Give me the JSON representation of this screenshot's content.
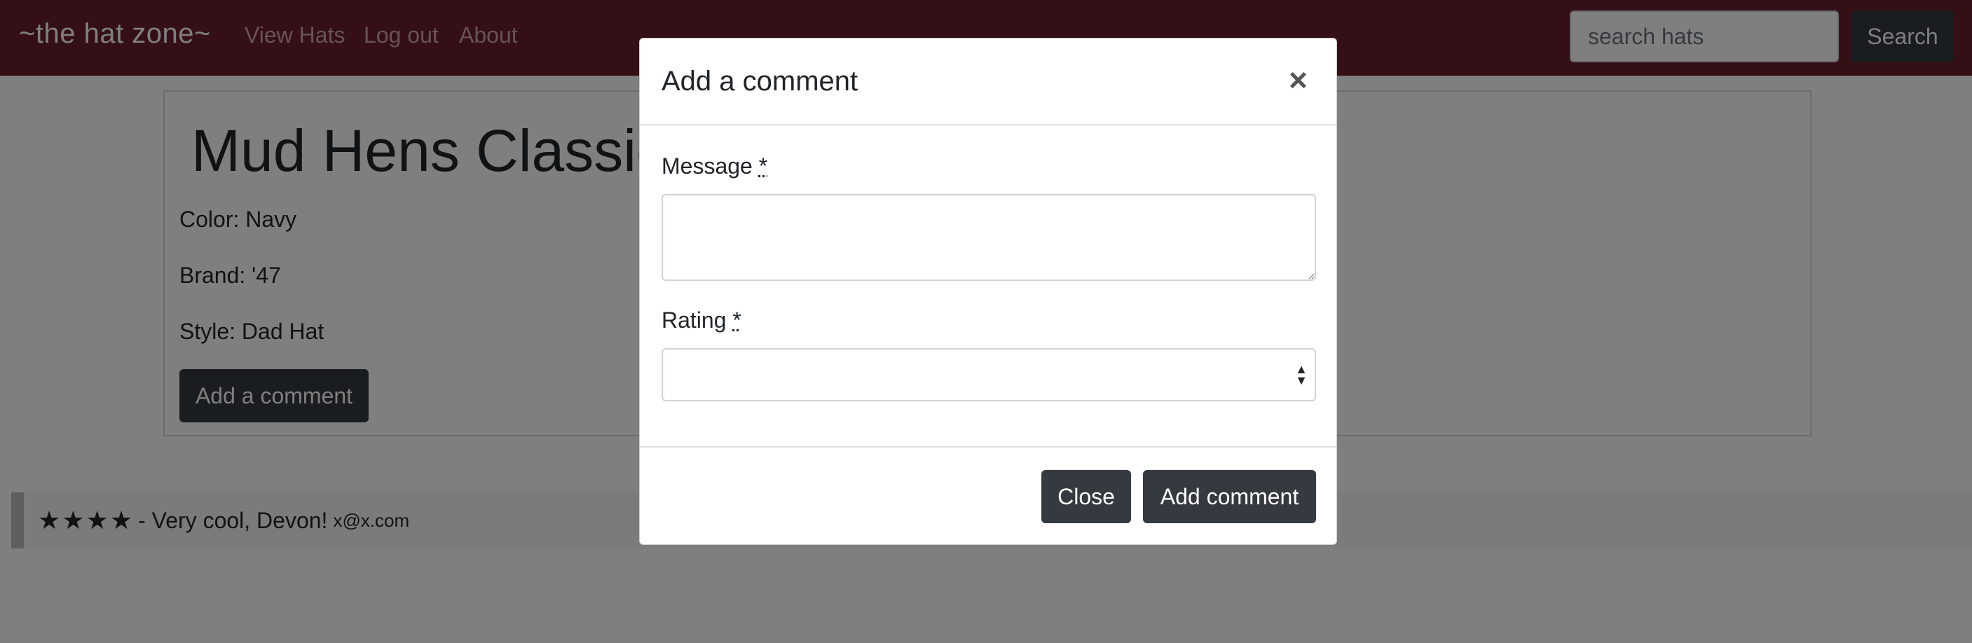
{
  "nav": {
    "brand": "~the hat zone~",
    "links": [
      "View Hats",
      "Log out",
      "About"
    ],
    "search_placeholder": "search hats",
    "search_button": "Search"
  },
  "hat": {
    "title": "Mud Hens Classic",
    "color": "Color: Navy",
    "brand": "Brand: '47",
    "style": "Style: Dad Hat",
    "add_comment_button": "Add a comment"
  },
  "comment": {
    "stars_glyphs": "★★★★",
    "rating": 4,
    "text": "- Very cool, Devon!",
    "email": "x@x.com"
  },
  "modal": {
    "title": "Add a comment",
    "close_glyph": "×",
    "message_label": "Message",
    "rating_label": "Rating",
    "required_mark": "*",
    "close_button": "Close",
    "submit_button": "Add comment"
  },
  "colors": {
    "navbar": "#6b1e2c",
    "button_dark": "#343a40"
  }
}
